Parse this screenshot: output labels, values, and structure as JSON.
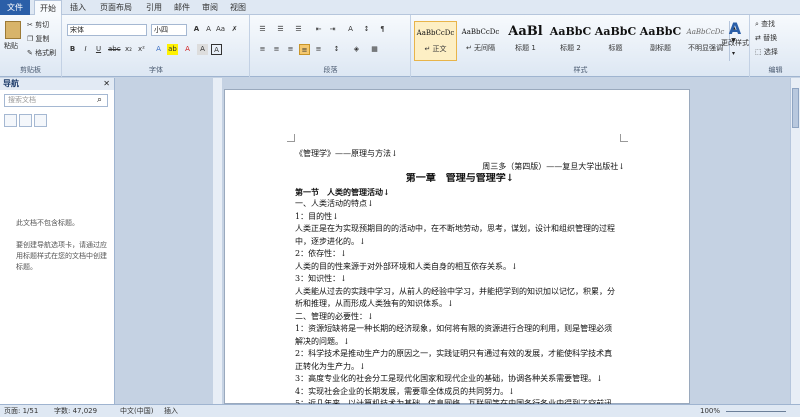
{
  "tabs": [
    "文件",
    "开始",
    "插入",
    "页面布局",
    "引用",
    "邮件",
    "审阅",
    "视图"
  ],
  "clipboard": {
    "paste": "粘贴",
    "cut": "剪切",
    "copy": "复制",
    "format_painter": "格式刷",
    "label": "剪贴板"
  },
  "font": {
    "name": "宋体",
    "size": "小四",
    "label": "字体"
  },
  "paragraph": {
    "label": "段落"
  },
  "styles": {
    "label": "样式",
    "items": [
      {
        "preview": "AaBbCcDc",
        "name": "↵ 正文"
      },
      {
        "preview": "AaBbCcDc",
        "name": "↵ 无间隔"
      },
      {
        "preview": "AaBl",
        "name": "标题 1"
      },
      {
        "preview": "AaBbC",
        "name": "标题 2"
      },
      {
        "preview": "AaBbC",
        "name": "标题"
      },
      {
        "preview": "AaBbC",
        "name": "副标题"
      },
      {
        "preview": "AaBbCcDc",
        "name": "不明显强调"
      }
    ],
    "change": "更改样式"
  },
  "editing": {
    "find": "查找",
    "replace": "替换",
    "select": "选择",
    "label": "编辑"
  },
  "nav": {
    "title": "导航",
    "search_placeholder": "搜索文档",
    "message": "此文档不包含标题。\n\n要创建导航选项卡，请通过应用标题样式在您的文档中创建标题。"
  },
  "document": {
    "lines": [
      "《管理学》——原理与方法↓",
      "周三多（第四版）——复旦大学出版社↓",
      "第一章　管理与管理学↓",
      "第一节　人类的管理活动↓",
      "一、人类活动的特点↓",
      "1：目的性↓",
      "人类正是在为实现预期目的的活动中，在不断地劳动，思考，谋划，设计和组织管理的过程",
      "中，逐步进化的。↓",
      "2：依存性：↓",
      "人类的目的性来源于对外部环境和人类自身的相互依存关系。↓",
      "3：知识性：↓",
      "人类能从过去的实践中学习，从前人的经验中学习，并能把学到的知识加以记忆，积累，分",
      "析和推理，从而形成人类独有的知识体系。↓",
      "二、管理的必要性：↓",
      "1：资源短缺将是一种长期的经济现象，如何将有限的资源进行合理的利用，则是管理必须",
      "解决的问题。↓",
      "2：科学技术是推动生产力的原因之一，实践证明只有通过有效的发展，才能使科学技术真",
      "正转化为生产力。↓",
      "3：高度专业化的社会分工是现代化国家和现代企业的基础，协调各种关系需要管理。↓",
      "4：实现社会企业的长期发展，需要靠全体成员的共同努力。↓",
      "5：近几年来，以计算机技术为基础，信息网络，互联网等在中国各行各业中得到了空前迅"
    ]
  },
  "status": {
    "page": "页面: 1/51",
    "words": "字数: 47,029",
    "lang": "中文(中国)",
    "mode": "插入",
    "zoom": "100%"
  }
}
